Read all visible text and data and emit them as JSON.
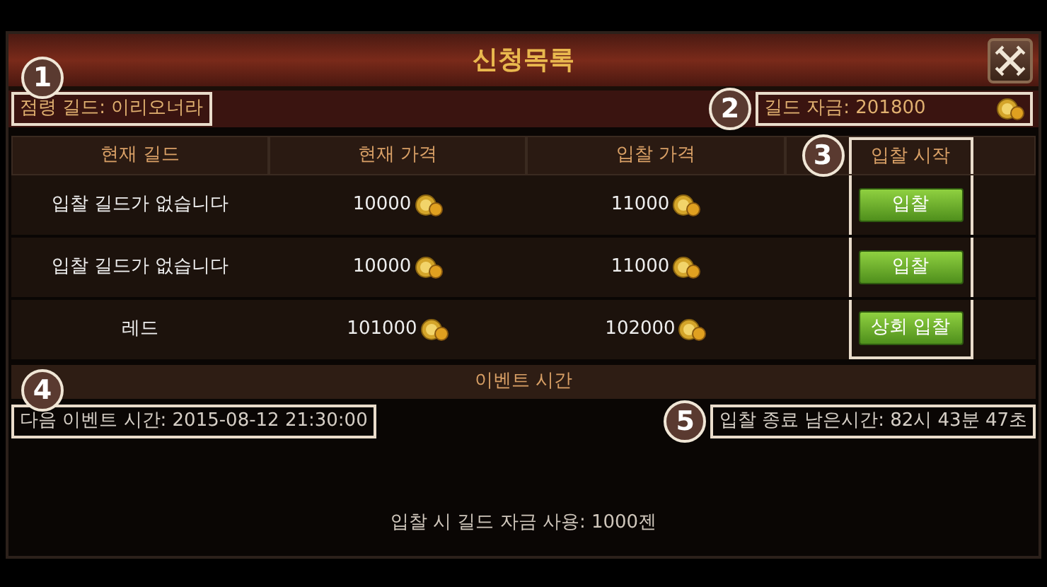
{
  "window": {
    "title": "신청목록"
  },
  "occupied_guild": {
    "text": "점령 길드: 이리오너라",
    "callout": "1"
  },
  "guild_funds": {
    "text": "길드 자금: 201800",
    "callout": "2"
  },
  "table": {
    "columns": [
      {
        "label": "현재 길드"
      },
      {
        "label": "현재 가격"
      },
      {
        "label": "입찰 가격"
      },
      {
        "label": "입찰 시작",
        "callout": "3"
      }
    ],
    "rows": [
      {
        "guild": "입찰 길드가 없습니다",
        "current_price": "10000",
        "bid_price": "11000",
        "action": "입찰"
      },
      {
        "guild": "입찰 길드가 없습니다",
        "current_price": "10000",
        "bid_price": "11000",
        "action": "입찰"
      },
      {
        "guild": "레드",
        "current_price": "101000",
        "bid_price": "102000",
        "action": "상회 입찰"
      }
    ]
  },
  "event": {
    "heading": "이벤트 시간",
    "next_event": {
      "text": "다음 이벤트 시간: 2015-08-12 21:30:00",
      "callout": "4"
    },
    "remaining": {
      "text": "입찰 종료 남은시간: 82시 43분 47초",
      "callout": "5"
    }
  },
  "footer_note": "입찰 시 길드 자금 사용: 1000젠"
}
